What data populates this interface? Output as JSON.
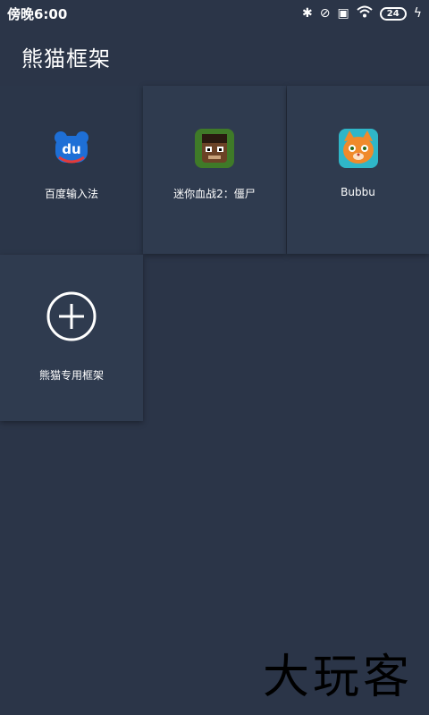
{
  "status_bar": {
    "time": "傍晚6:00",
    "battery": "24",
    "icons": [
      "bluetooth-icon",
      "alarm-off-icon",
      "sim-icon",
      "wifi-icon",
      "battery-icon",
      "charging-icon"
    ]
  },
  "appbar": {
    "title": "熊猫框架"
  },
  "apps": [
    {
      "label": "百度输入法",
      "icon": "baidu-input-icon",
      "color": "#1e6fd6"
    },
    {
      "label": "迷你血战2：僵尸",
      "icon": "mini-zombie-game-icon",
      "color": "#3f7a28"
    },
    {
      "label": "Bubbu",
      "icon": "bubbu-cat-icon",
      "color": "#f08a2b"
    }
  ],
  "add_tile": {
    "label": "熊猫专用框架",
    "icon": "add-circle-icon"
  },
  "watermark": "大玩客",
  "colors": {
    "background": "#2b3548",
    "tile": "#2f3b4f"
  }
}
